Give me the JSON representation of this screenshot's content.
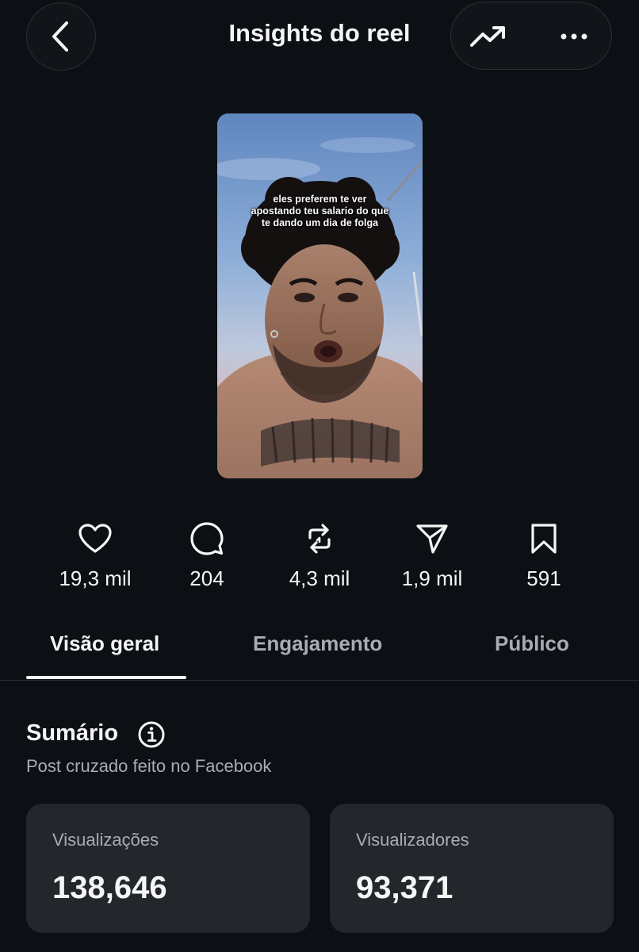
{
  "header": {
    "title": "Insights do reel"
  },
  "reel": {
    "caption_line1": "eles preferem te ver",
    "caption_line2": "apostando teu salario do que",
    "caption_line3": "te dando um dia de folga"
  },
  "stats": [
    {
      "icon": "heart-icon",
      "value": "19,3 mil"
    },
    {
      "icon": "comment-icon",
      "value": "204"
    },
    {
      "icon": "repost-icon",
      "value": "4,3 mil"
    },
    {
      "icon": "send-icon",
      "value": "1,9 mil"
    },
    {
      "icon": "bookmark-icon",
      "value": "591"
    }
  ],
  "tabs": [
    {
      "label": "Visão geral",
      "active": true
    },
    {
      "label": "Engajamento",
      "active": false
    },
    {
      "label": "Público",
      "active": false
    }
  ],
  "summary": {
    "title": "Sumário",
    "subtitle": "Post cruzado feito no Facebook"
  },
  "metrics": [
    {
      "label": "Visualizações",
      "value": "138,646"
    },
    {
      "label": "Visualizadores",
      "value": "93,371"
    }
  ],
  "colors": {
    "background": "#0c1014",
    "card": "#23272c",
    "text_primary": "#f5f5f5",
    "text_secondary": "#a8adb3"
  }
}
